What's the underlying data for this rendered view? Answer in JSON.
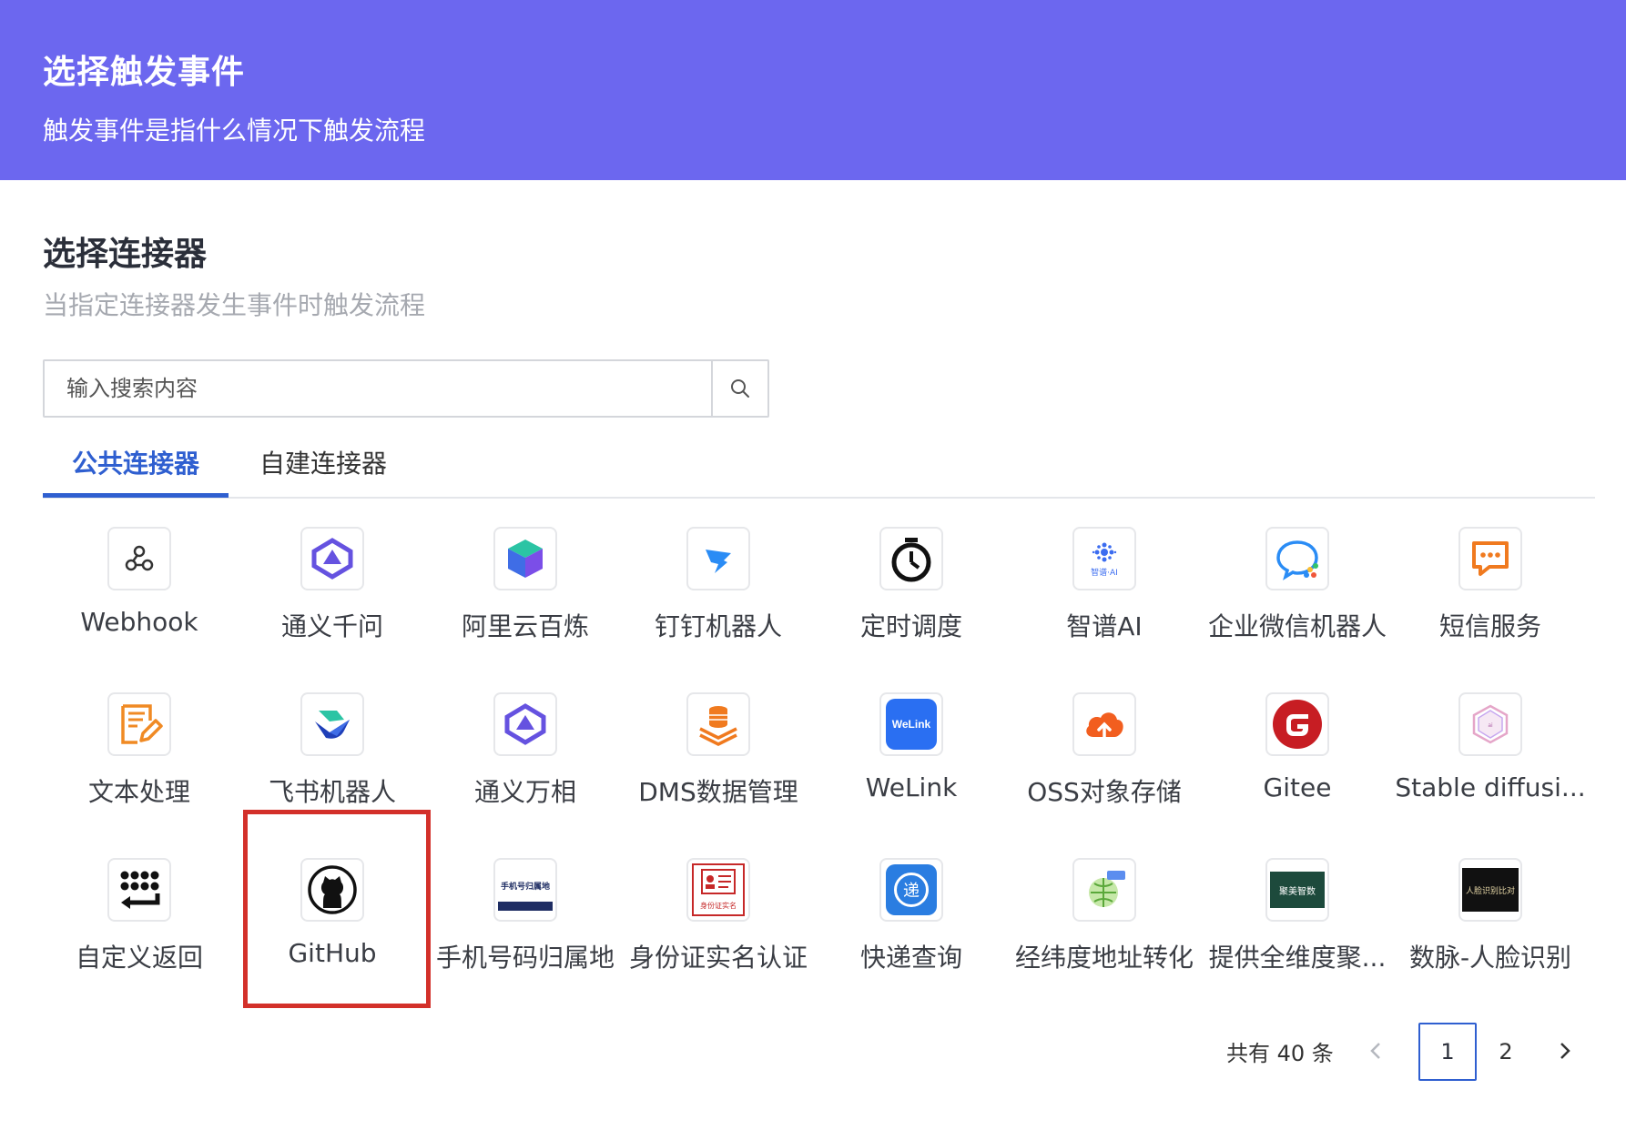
{
  "header": {
    "title": "选择触发事件",
    "subtitle": "触发事件是指什么情况下触发流程"
  },
  "section": {
    "title": "选择连接器",
    "subtitle": "当指定连接器发生事件时触发流程"
  },
  "search": {
    "placeholder": "输入搜索内容",
    "value": "",
    "icon": "search-icon"
  },
  "tabs": [
    {
      "label": "公共连接器",
      "active": true
    },
    {
      "label": "自建连接器",
      "active": false
    }
  ],
  "connectors": [
    {
      "label": "Webhook",
      "icon": "webhook-icon"
    },
    {
      "label": "通义千问",
      "icon": "tongyi-qianwen-icon"
    },
    {
      "label": "阿里云百炼",
      "icon": "aliyun-bailian-icon"
    },
    {
      "label": "钉钉机器人",
      "icon": "dingtalk-robot-icon"
    },
    {
      "label": "定时调度",
      "icon": "timer-icon"
    },
    {
      "label": "智谱AI",
      "icon": "zhipu-ai-icon"
    },
    {
      "label": "企业微信机器人",
      "icon": "wecom-robot-icon"
    },
    {
      "label": "短信服务",
      "icon": "sms-icon"
    },
    {
      "label": "文本处理",
      "icon": "text-edit-icon"
    },
    {
      "label": "飞书机器人",
      "icon": "feishu-robot-icon"
    },
    {
      "label": "通义万相",
      "icon": "tongyi-wanxiang-icon"
    },
    {
      "label": "DMS数据管理",
      "icon": "dms-database-icon"
    },
    {
      "label": "WeLink",
      "icon": "welink-icon",
      "icon_text": "WeLink"
    },
    {
      "label": "OSS对象存储",
      "icon": "oss-cloud-icon"
    },
    {
      "label": "Gitee",
      "icon": "gitee-icon"
    },
    {
      "label": "Stable diffusi...",
      "icon": "stable-diffusion-icon"
    },
    {
      "label": "自定义返回",
      "icon": "custom-return-icon"
    },
    {
      "label": "GitHub",
      "icon": "github-icon"
    },
    {
      "label": "手机号码归属地",
      "icon": "phone-location-icon",
      "icon_text": "手机号归属地"
    },
    {
      "label": "身份证实名认证",
      "icon": "id-card-icon",
      "icon_text": "身份证实名"
    },
    {
      "label": "快递查询",
      "icon": "express-query-icon",
      "icon_text": "递"
    },
    {
      "label": "经纬度地址转化",
      "icon": "geo-convert-icon"
    },
    {
      "label": "提供全维度聚...",
      "icon": "aggregate-data-icon",
      "icon_text": "聚美智数"
    },
    {
      "label": "数脉-人脸识别",
      "icon": "face-recognition-icon",
      "icon_text": "人脸识别比对"
    }
  ],
  "pagination": {
    "total": "共有 40 条",
    "pages": [
      "1",
      "2"
    ],
    "current": "1"
  },
  "colors": {
    "header_bg": "#6c67ef",
    "accent": "#2f5fd0",
    "highlight_box": "#d3302a"
  }
}
